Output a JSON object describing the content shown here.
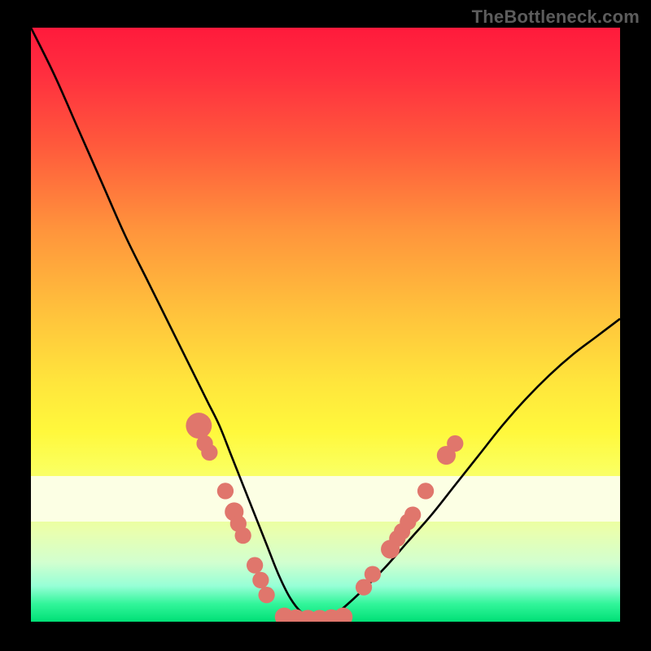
{
  "watermark": "TheBottleneck.com",
  "colors": {
    "curve": "#000000",
    "marker_fill": "#e0766c",
    "marker_stroke": "#c9584d",
    "frame_bg": "#000000"
  },
  "chart_data": {
    "type": "line",
    "title": "",
    "xlabel": "",
    "ylabel": "",
    "xlim": [
      0,
      100
    ],
    "ylim": [
      0,
      100
    ],
    "grid": false,
    "legend": false,
    "series": [
      {
        "name": "bottleneck-curve",
        "x": [
          0,
          4,
          8,
          12,
          16,
          20,
          24,
          28,
          30,
          32,
          34,
          36,
          38,
          40,
          42,
          44,
          46,
          48,
          50,
          52,
          56,
          60,
          64,
          68,
          72,
          76,
          80,
          84,
          88,
          92,
          96,
          100
        ],
        "y": [
          100,
          92,
          83,
          74,
          65,
          57,
          49,
          41,
          37,
          33,
          28,
          23,
          18,
          13,
          8,
          4,
          1.5,
          0.5,
          0.5,
          1.5,
          5,
          9,
          13.5,
          18,
          23,
          28,
          33,
          37.5,
          41.5,
          45,
          48,
          51
        ]
      }
    ],
    "markers": [
      {
        "x": 28.5,
        "y": 33,
        "r": 2.2
      },
      {
        "x": 29.5,
        "y": 30,
        "r": 1.4
      },
      {
        "x": 30.3,
        "y": 28.5,
        "r": 1.4
      },
      {
        "x": 33.0,
        "y": 22.0,
        "r": 1.4
      },
      {
        "x": 34.5,
        "y": 18.5,
        "r": 1.6
      },
      {
        "x": 35.2,
        "y": 16.5,
        "r": 1.4
      },
      {
        "x": 36.0,
        "y": 14.5,
        "r": 1.4
      },
      {
        "x": 38.0,
        "y": 9.5,
        "r": 1.4
      },
      {
        "x": 39.0,
        "y": 7.0,
        "r": 1.4
      },
      {
        "x": 40.0,
        "y": 4.5,
        "r": 1.4
      },
      {
        "x": 43.0,
        "y": 0.8,
        "r": 1.6
      },
      {
        "x": 45.0,
        "y": 0.5,
        "r": 1.6
      },
      {
        "x": 47.0,
        "y": 0.4,
        "r": 1.6
      },
      {
        "x": 49.0,
        "y": 0.4,
        "r": 1.6
      },
      {
        "x": 51.0,
        "y": 0.5,
        "r": 1.6
      },
      {
        "x": 53.0,
        "y": 0.8,
        "r": 1.6
      },
      {
        "x": 56.5,
        "y": 5.8,
        "r": 1.4
      },
      {
        "x": 58.0,
        "y": 8.0,
        "r": 1.4
      },
      {
        "x": 61.0,
        "y": 12.2,
        "r": 1.6
      },
      {
        "x": 62.2,
        "y": 14.0,
        "r": 1.4
      },
      {
        "x": 63.0,
        "y": 15.2,
        "r": 1.4
      },
      {
        "x": 64.0,
        "y": 16.8,
        "r": 1.4
      },
      {
        "x": 64.8,
        "y": 18.0,
        "r": 1.4
      },
      {
        "x": 67.0,
        "y": 22.0,
        "r": 1.4
      },
      {
        "x": 70.5,
        "y": 28.0,
        "r": 1.6
      },
      {
        "x": 72.0,
        "y": 30.0,
        "r": 1.4
      }
    ],
    "ivory_band": {
      "y_top": 24.5,
      "y_bottom": 16.8
    }
  }
}
